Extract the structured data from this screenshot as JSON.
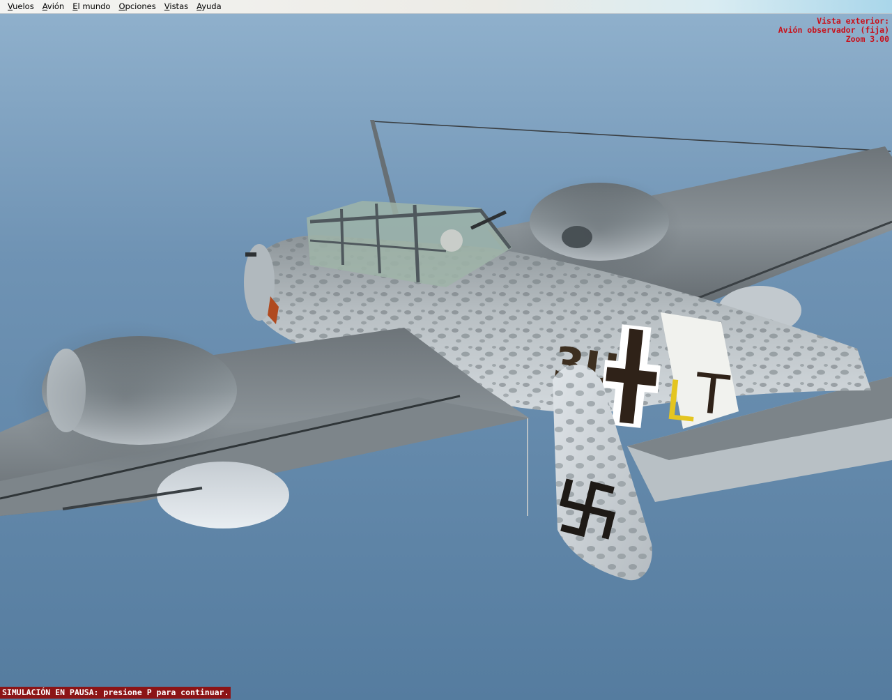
{
  "menu": {
    "items": [
      {
        "label": "Vuelos"
      },
      {
        "label": "Avión"
      },
      {
        "label": "El mundo"
      },
      {
        "label": "Opciones"
      },
      {
        "label": "Vistas"
      },
      {
        "label": "Ayuda"
      }
    ]
  },
  "view_info": {
    "line1": "Vista exterior:",
    "line2": "Avión observador (fija)",
    "line3": "Zoom 3.00"
  },
  "status": {
    "pause_message": "SIMULACIÓN EN PAUSA: presione P para continuar."
  },
  "aircraft": {
    "fuselage_code": "3U",
    "unit_letters": "LT"
  },
  "colors": {
    "sky_sea": "#5f86a9",
    "overlay_text": "#c8101a",
    "pause_background": "#8c1416",
    "unit_letter_yellow": "#e4c520"
  }
}
